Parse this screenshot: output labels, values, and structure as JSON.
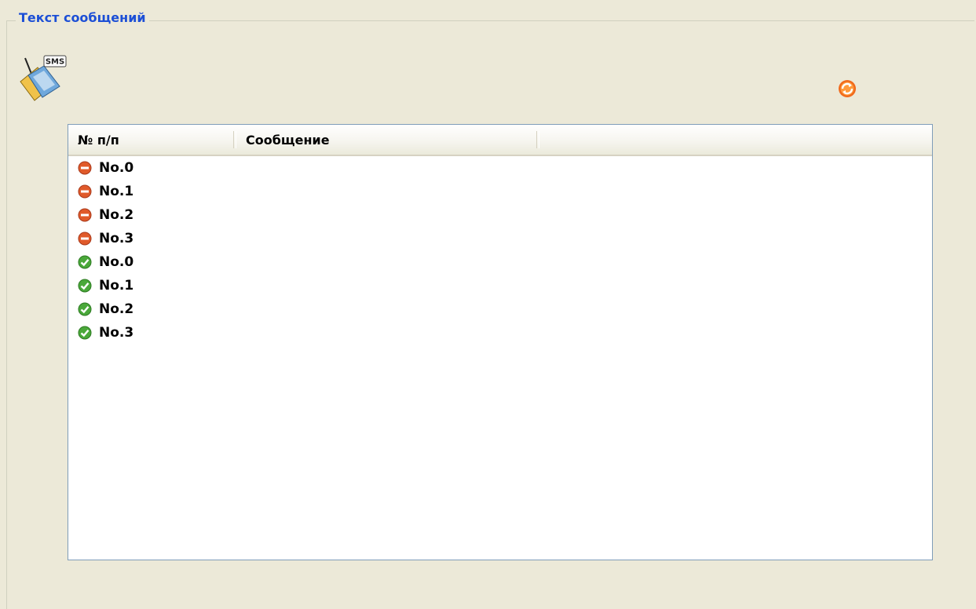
{
  "group": {
    "title": "Текст сообщений"
  },
  "toolbar": {
    "icon_badge": "SMS",
    "refresh_icon": "refresh-icon"
  },
  "list": {
    "columns": [
      {
        "label": "№ п/п"
      },
      {
        "label": "Сообщение"
      },
      {
        "label": ""
      }
    ],
    "rows": [
      {
        "status": "error",
        "label": "No.0",
        "message": ""
      },
      {
        "status": "error",
        "label": "No.1",
        "message": ""
      },
      {
        "status": "error",
        "label": "No.2",
        "message": ""
      },
      {
        "status": "error",
        "label": "No.3",
        "message": ""
      },
      {
        "status": "ok",
        "label": "No.0",
        "message": ""
      },
      {
        "status": "ok",
        "label": "No.1",
        "message": ""
      },
      {
        "status": "ok",
        "label": "No.2",
        "message": ""
      },
      {
        "status": "ok",
        "label": "No.3",
        "message": ""
      }
    ]
  },
  "colors": {
    "error": "#e05a2a",
    "ok": "#4aa83a",
    "title": "#1c4fd6",
    "background": "#ece9d8"
  }
}
